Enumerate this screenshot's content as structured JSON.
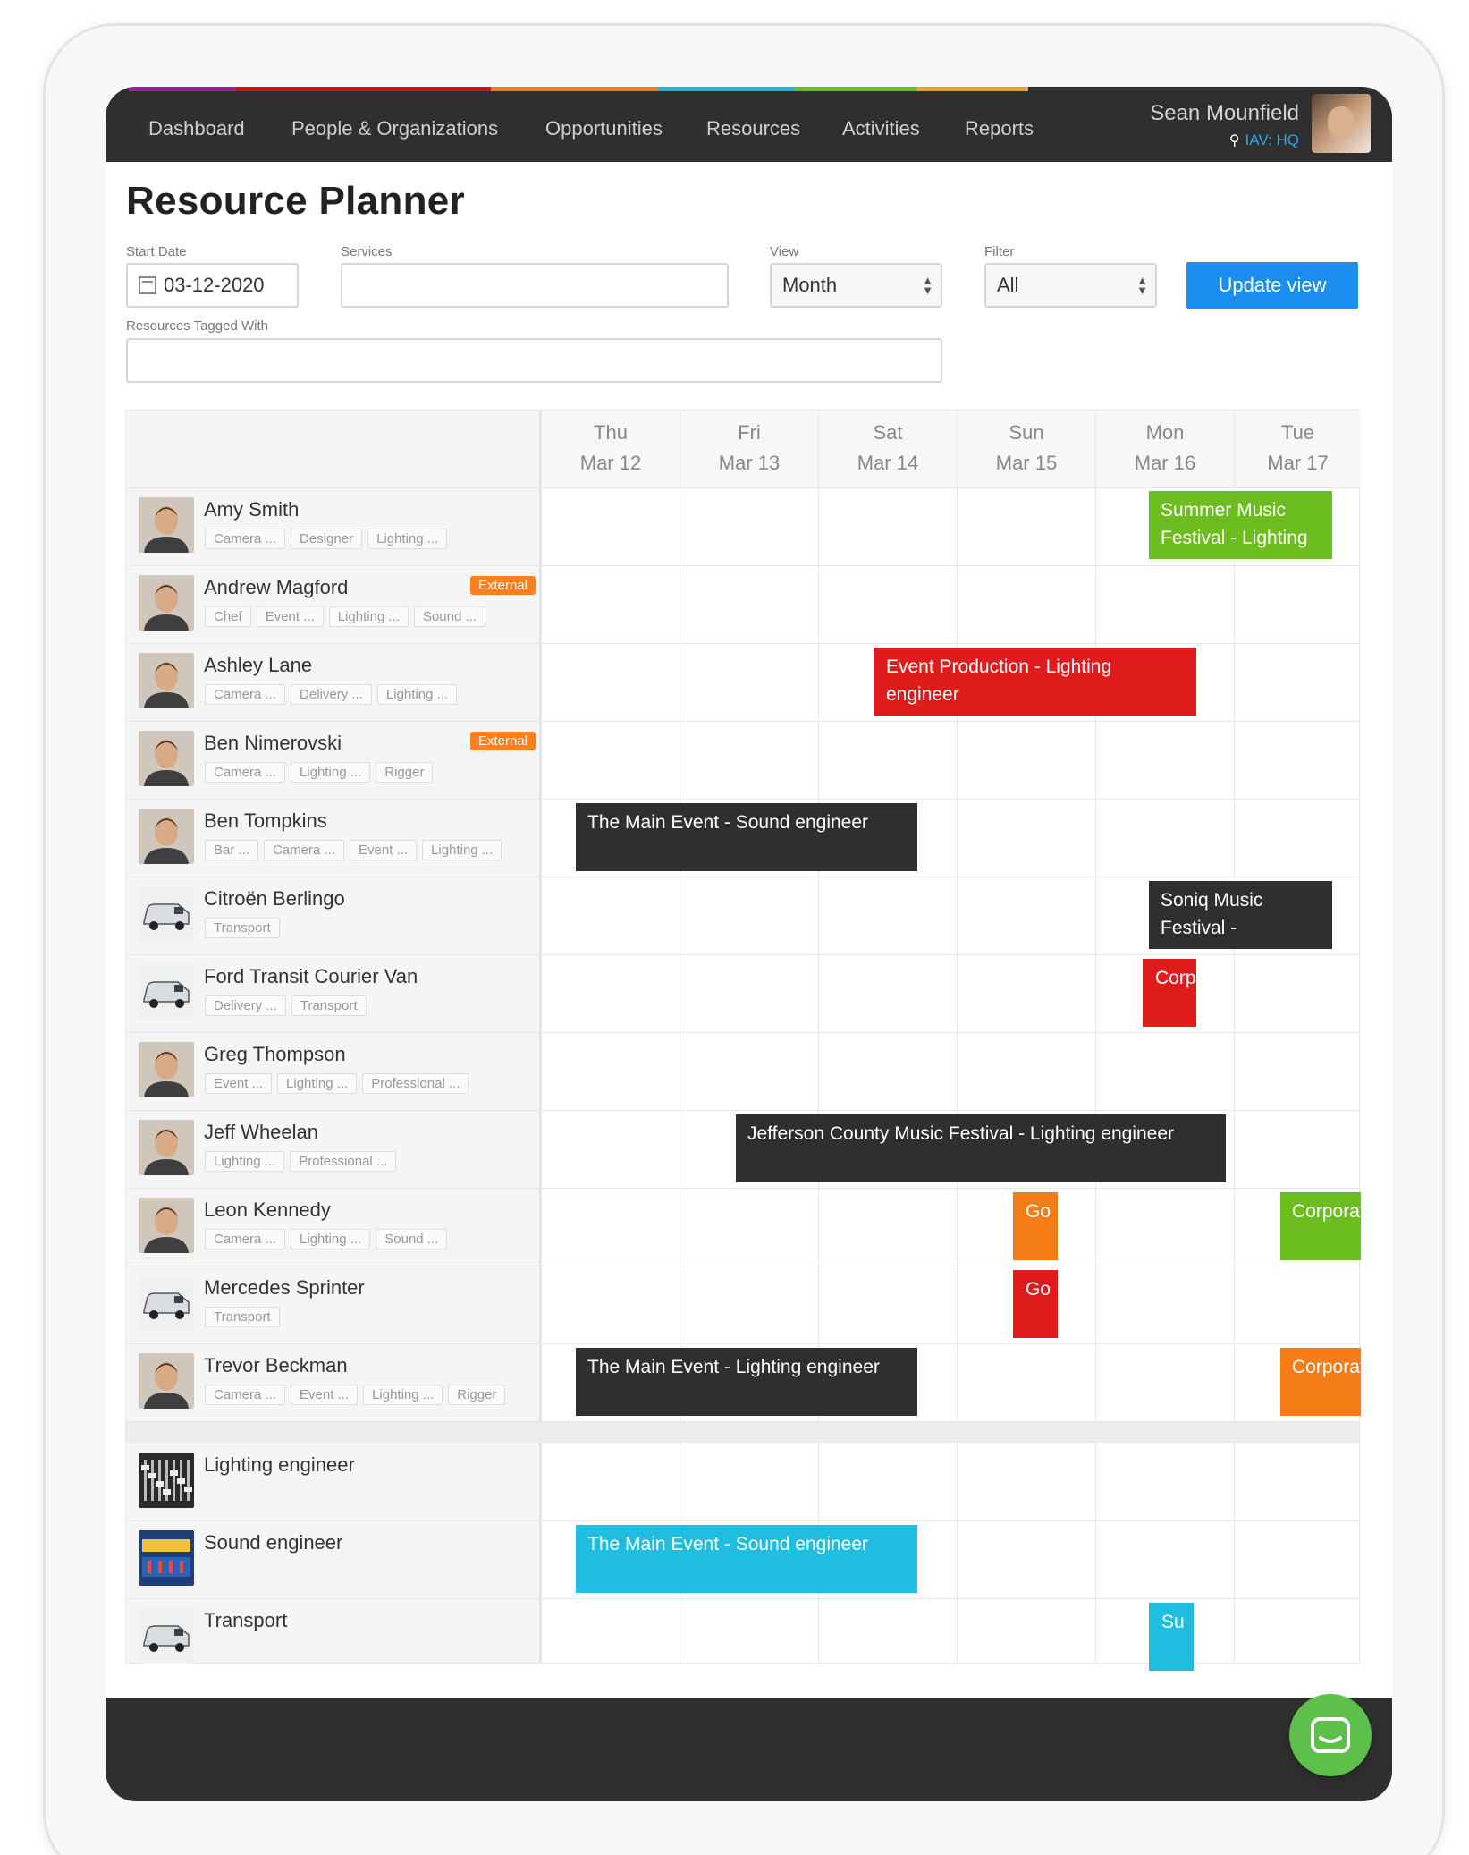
{
  "nav": {
    "items": [
      "Dashboard",
      "People & Organizations",
      "Opportunities",
      "Resources",
      "Activities",
      "Reports"
    ],
    "stripe_colors": [
      "#a31ba3",
      "#cc1818",
      "#f07a16",
      "#1fb3e0",
      "#6cbe1e",
      "#f0a020"
    ],
    "user_name": "Sean Mounfield",
    "location": "IAV: HQ"
  },
  "page": {
    "title": "Resource Planner",
    "start_date_label": "Start Date",
    "start_date": "03-12-2020",
    "services_label": "Services",
    "services_value": "",
    "view_label": "View",
    "view_value": "Month",
    "filter_label": "Filter",
    "filter_value": "All",
    "tagged_label": "Resources Tagged With",
    "tagged_value": "",
    "update_button": "Update view"
  },
  "days": [
    {
      "name": "Thu",
      "date": "Mar 12"
    },
    {
      "name": "Fri",
      "date": "Mar 13"
    },
    {
      "name": "Sat",
      "date": "Mar 14"
    },
    {
      "name": "Sun",
      "date": "Mar 15"
    },
    {
      "name": "Mon",
      "date": "Mar 16"
    },
    {
      "name": "Tue",
      "date": "Mar 17"
    }
  ],
  "resources": [
    {
      "name": "Amy Smith",
      "tags": [
        "Camera ...",
        "Designer",
        "Lighting ..."
      ],
      "external": "",
      "avatar": "person-avatar"
    },
    {
      "name": "Andrew Magford",
      "tags": [
        "Chef",
        "Event ...",
        "Lighting ...",
        "Sound ..."
      ],
      "external": "External",
      "avatar": "person-avatar"
    },
    {
      "name": "Ashley Lane",
      "tags": [
        "Camera ...",
        "Delivery ...",
        "Lighting ..."
      ],
      "external": "",
      "avatar": "person-avatar"
    },
    {
      "name": "Ben Nimerovski",
      "tags": [
        "Camera ...",
        "Lighting ...",
        "Rigger"
      ],
      "external": "External",
      "avatar": "person-avatar"
    },
    {
      "name": "Ben Tompkins",
      "tags": [
        "Bar ...",
        "Camera ...",
        "Event ...",
        "Lighting ..."
      ],
      "external": "",
      "avatar": "person-avatar"
    },
    {
      "name": "Citroën Berlingo",
      "tags": [
        "Transport"
      ],
      "external": "",
      "avatar": "van-avatar"
    },
    {
      "name": "Ford Transit Courier Van",
      "tags": [
        "Delivery ...",
        "Transport"
      ],
      "external": "",
      "avatar": "van-avatar"
    },
    {
      "name": "Greg Thompson",
      "tags": [
        "Event ...",
        "Lighting ...",
        "Professional ..."
      ],
      "external": "",
      "avatar": "person-avatar"
    },
    {
      "name": "Jeff Wheelan",
      "tags": [
        "Lighting ...",
        "Professional ..."
      ],
      "external": "",
      "avatar": "person-avatar"
    },
    {
      "name": "Leon Kennedy",
      "tags": [
        "Camera ...",
        "Lighting ...",
        "Sound ..."
      ],
      "external": "",
      "avatar": "person-avatar"
    },
    {
      "name": "Mercedes Sprinter",
      "tags": [
        "Transport"
      ],
      "external": "",
      "avatar": "van-avatar"
    },
    {
      "name": "Trevor Beckman",
      "tags": [
        "Camera ...",
        "Event ...",
        "Lighting ...",
        "Rigger"
      ],
      "external": "",
      "avatar": "person-avatar"
    }
  ],
  "roles": [
    {
      "name": "Lighting engineer",
      "avatar": "mixer-avatar"
    },
    {
      "name": "Sound engineer",
      "avatar": "soundboard-avatar"
    },
    {
      "name": "Transport",
      "avatar": "van-avatar"
    }
  ],
  "events": [
    {
      "row": 0,
      "text": "Summer Music Festival - Lighting",
      "color": "#6cbe1e"
    },
    {
      "row": 2,
      "text": "Event Production - Lighting engineer",
      "color": "#e01b1b"
    },
    {
      "row": 4,
      "text": "The Main Event - Sound engineer",
      "color": "#2f2f2f"
    },
    {
      "row": 5,
      "text": "Soniq Music Festival -",
      "color": "#2f2f2f"
    },
    {
      "row": 6,
      "text": "Corp",
      "color": "#e01b1b"
    },
    {
      "row": 8,
      "text": "Jefferson County Music Festival - Lighting engineer",
      "color": "#2f2f2f"
    },
    {
      "row": 9,
      "text": "Go",
      "color": "#f57c16"
    },
    {
      "row": 9,
      "text": "Corporat",
      "color": "#6cbe1e"
    },
    {
      "row": 10,
      "text": "Go",
      "color": "#e01b1b"
    },
    {
      "row": 11,
      "text": "The Main Event - Lighting engineer",
      "color": "#2f2f2f"
    },
    {
      "row": 11,
      "text": "Corporat",
      "color": "#f57c16"
    },
    {
      "row": 13,
      "text": "The Main Event - Sound engineer",
      "color": "#1fbde0"
    },
    {
      "row": 14,
      "text": "Su",
      "color": "#1fbde0"
    }
  ]
}
